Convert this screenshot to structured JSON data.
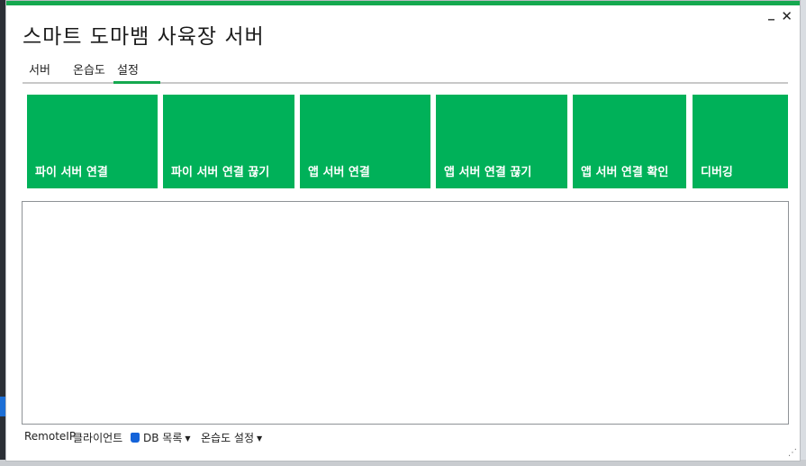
{
  "app": {
    "title": "스마트 도마뱀 사육장 서버"
  },
  "window": {
    "minimize_glyph": "_",
    "close_glyph": "✕"
  },
  "tabs": [
    {
      "label": "서버"
    },
    {
      "label": "온습도"
    },
    {
      "label": "설정"
    }
  ],
  "active_tab": "설정",
  "tiles": [
    {
      "label": "파이 서버 연결"
    },
    {
      "label": "파이 서버 연결 끊기"
    },
    {
      "label": "앱 서버 연결"
    },
    {
      "label": "앱 서버 연결 끊기"
    },
    {
      "label": "앱 서버 연결 확인"
    },
    {
      "label": "디버깅"
    }
  ],
  "statusbar": {
    "remote_ip": "RemoteIP",
    "client": "클라이언트",
    "db_list": "DB 목록",
    "humid_settings": "온습도 설정"
  },
  "colors": {
    "accent": "#15a84f",
    "tile": "#00b159",
    "db_icon": "#1463d9"
  },
  "icons": {
    "db": "database-icon",
    "dropdown": "caret-down-icon",
    "grip": "resize-grip-icon"
  }
}
